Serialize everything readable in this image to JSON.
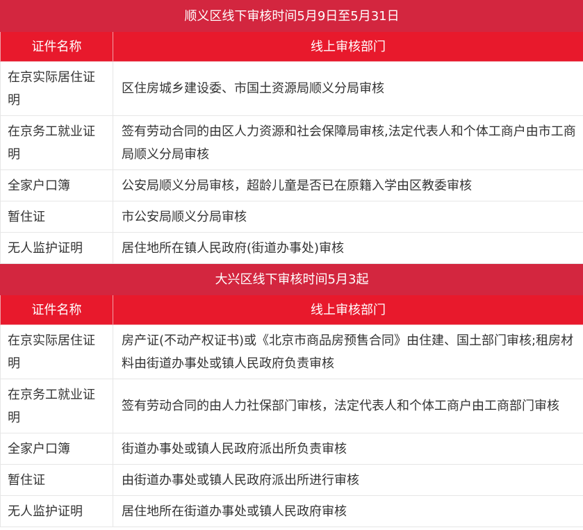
{
  "sections": [
    {
      "title": "顺义区线下审核时间5月9日至5月31日",
      "header": [
        "证件名称",
        "线上审核部门"
      ],
      "rows": [
        {
          "label": "在京实际居住证明",
          "content": "区住房城乡建设委、市国土资源局顺义分局审核"
        },
        {
          "label": "在京务工就业证明",
          "content": "签有劳动合同的由区人力资源和社会保障局审核,法定代表人和个体工商户由市工商局顺义分局审核"
        },
        {
          "label": "全家户口簿",
          "content": "公安局顺义分局审核，超龄儿童是否已在原籍入学由区教委审核"
        },
        {
          "label": "暂住证",
          "content": "市公安局顺义分局审核"
        },
        {
          "label": "无人监护证明",
          "content": "居住地所在镇人民政府(街道办事处)审核"
        }
      ]
    },
    {
      "title": "大兴区线下审核时间5月3起",
      "header": [
        "证件名称",
        "线上审核部门"
      ],
      "rows": [
        {
          "label": "在京实际居住证明",
          "content": "房产证(不动产权证书)或《北京市商品房预售合同》由住建、国土部门审核;租房材料由街道办事处或镇人民政府负责审核"
        },
        {
          "label": "在京务工就业证明",
          "content": "签有劳动合同的由人力社保部门审核，法定代表人和个体工商户由工商部门审核"
        },
        {
          "label": "全家户口簿",
          "content": "街道办事处或镇人民政府派出所负责审核"
        },
        {
          "label": "暂住证",
          "content": "由街道办事处或镇人民政府派出所进行审核"
        },
        {
          "label": "无人监护证明",
          "content": "居住地所在街道办事处或镇人民政府审核"
        }
      ]
    }
  ]
}
